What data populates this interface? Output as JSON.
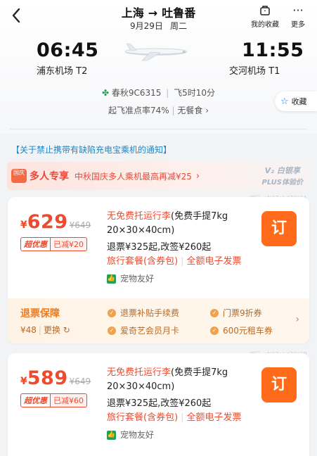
{
  "header": {
    "origin": "上海",
    "destination": "吐鲁番",
    "date": "9月29日",
    "weekday": "周二",
    "favorites_label": "我的收藏",
    "more_label": "更多"
  },
  "flight": {
    "depart_time": "06:45",
    "depart_airport": "浦东机场 T2",
    "arrive_time": "11:55",
    "arrive_airport": "交河机场 T1",
    "airline_flight": "春秋9C6315",
    "duration": "飞5时10分",
    "ontime_rate": "起飞准点率74%",
    "meal": "无餐食 ›"
  },
  "collect_label": "收藏",
  "notice": "【关于禁止携带有缺陷充电宝乘机的通知】",
  "promo": {
    "badge": "国庆",
    "title": "多人专享",
    "text": "中秋国庆多人乘机最高再减¥25",
    "plus_line1": "V₂ 白银享",
    "plus_line2": "PLUS体验价"
  },
  "watermark": "编码: sN9Zobd7Or3A",
  "watermark2": "编码: sN9Zobd7Or3B",
  "offers": [
    {
      "price": "629",
      "original_price": "¥649",
      "tag_label": "超优惠",
      "discount": "已减¥20",
      "luggage": "无免费托运行李",
      "carry_on": "(免费手提7kg 20×30×40cm)",
      "refund": "退票¥325起,改签¥260起",
      "package": "旅行套餐(含券包)",
      "invoice": "全额电子发票",
      "pet": "宠物友好",
      "book": "订",
      "guarantee": {
        "title": "退票保障",
        "price": "¥48",
        "change": "更换",
        "items": [
          "退票补贴手续费",
          "门票9折券",
          "爱奇艺会员月卡",
          "600元租车券"
        ]
      }
    },
    {
      "price": "589",
      "original_price": "¥649",
      "tag_label": "超优惠",
      "discount": "已减¥60",
      "luggage": "无免费托运行李",
      "carry_on": "(免费手提7kg 20×30×40cm)",
      "refund": "退票¥325起,改签¥260起",
      "package": "旅行套餐(含券包)",
      "invoice": "全额电子发票",
      "pet": "宠物友好",
      "book": "订"
    }
  ],
  "colors": {
    "accent_red": "#ef4a2e",
    "book_orange": "#ff6b1a",
    "guarantee_orange": "#ef7a1e",
    "link_blue": "#1d87c8"
  }
}
